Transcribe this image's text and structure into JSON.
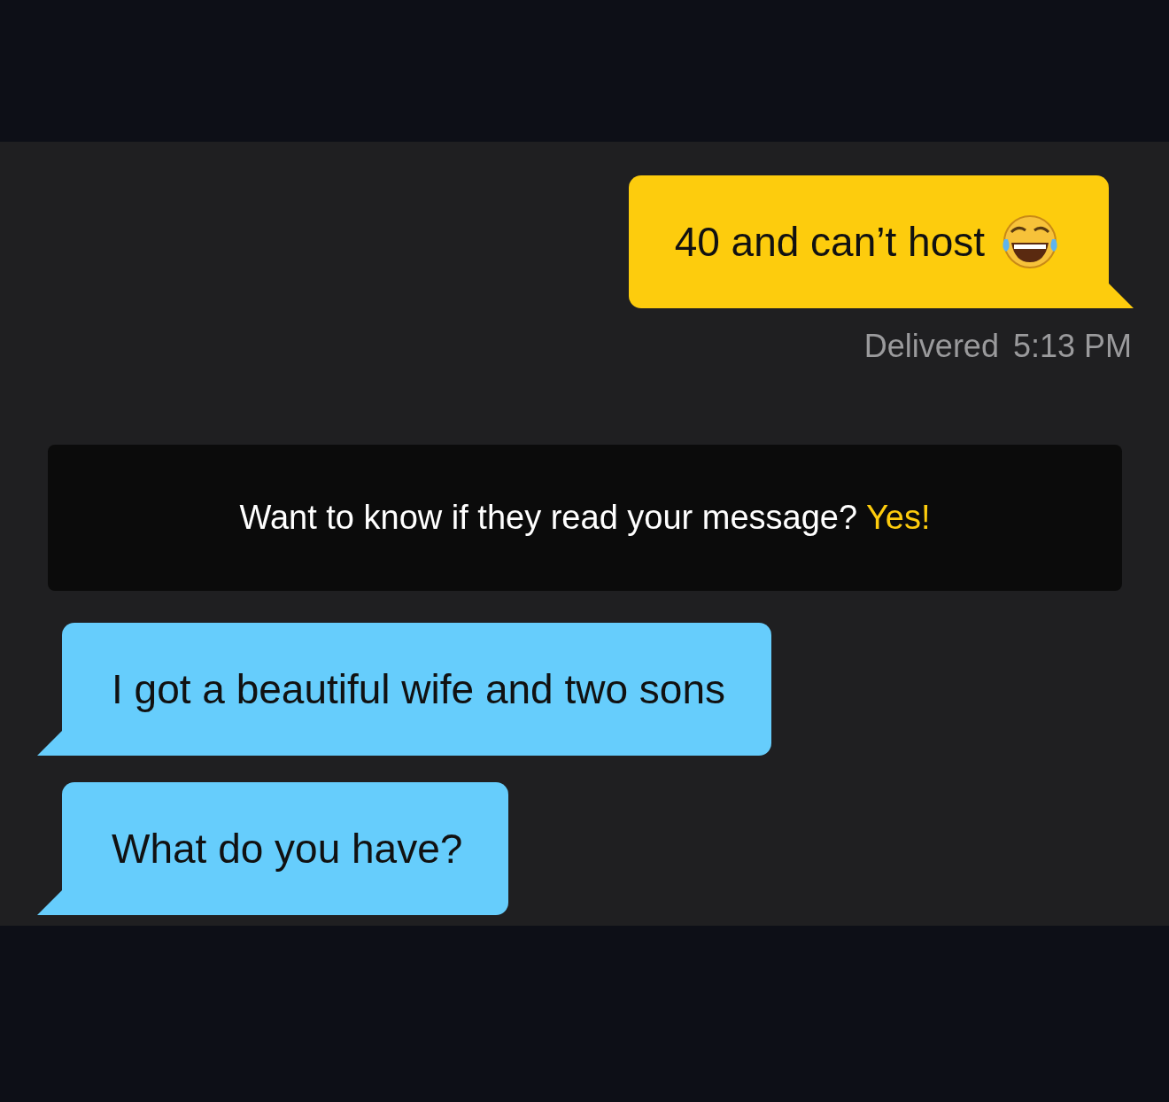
{
  "sent_message": {
    "text": "40 and can’t host"
  },
  "delivery_status": {
    "label": "Delivered",
    "time": "5:13 PM"
  },
  "read_receipt_banner": {
    "text": "Want to know if they read your message?",
    "link": "Yes!"
  },
  "received_messages": [
    {
      "text": "I got a beautiful wife and two sons"
    },
    {
      "text": "What do you have?"
    }
  ]
}
